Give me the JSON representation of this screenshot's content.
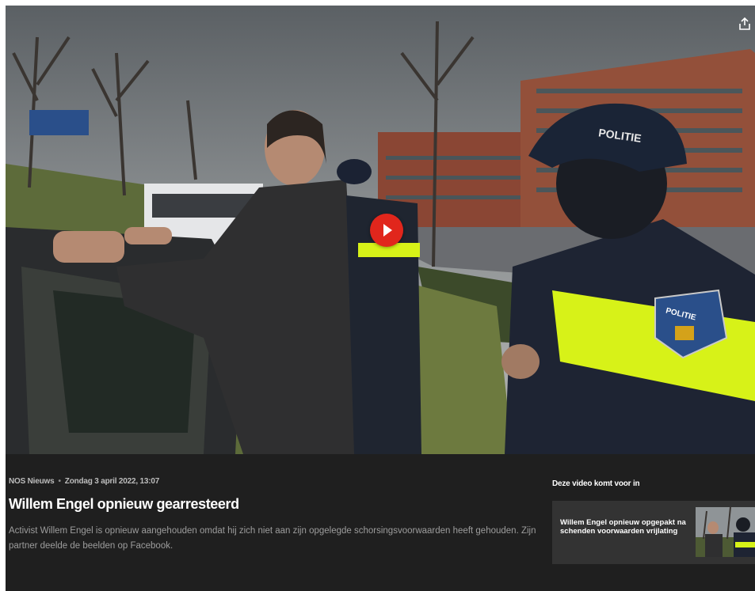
{
  "video": {
    "play_label": "play-icon",
    "share_label": "share-icon",
    "signage": {
      "cap_text": "POLITIE",
      "badge_text": "POLITIE"
    }
  },
  "article": {
    "source": "NOS Nieuws",
    "separator": "•",
    "date": "Zondag 3 april 2022, 13:07",
    "title": "Willem Engel opnieuw gearresteerd",
    "description": "Activist Willem Engel is opnieuw aangehouden omdat hij zich niet aan zijn opgelegde schorsingsvoorwaarden heeft gehouden. Zijn partner deelde de beelden op Facebook."
  },
  "related": {
    "heading": "Deze video komt voor in",
    "card_title": "Willem Engel opnieuw opgepakt na schenden voorwaarden vrijlating"
  },
  "colors": {
    "background": "#1f1f1f",
    "card": "#333333",
    "play_red": "#e1261c",
    "reflective_yellow": "#d7f218"
  }
}
